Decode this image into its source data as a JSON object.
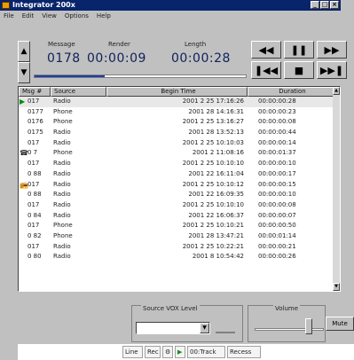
{
  "window": {
    "title": "Integrator 200x",
    "controls": [
      "_",
      "□",
      "×"
    ]
  },
  "menu": [
    "File",
    "Edit",
    "View",
    "Options",
    "Help"
  ],
  "transport": {
    "message_label": "Message",
    "message_value": "0178",
    "render_label": "Render",
    "render_value": "00:00:09",
    "length_label": "Length",
    "length_value": "00:00:28",
    "progress_fraction": 0.33,
    "buttons": {
      "rewind": "◀◀",
      "pause": "❚❚",
      "forward": "▶▶",
      "prev": "❚◀◀",
      "stop": "■",
      "next": "▶▶❚",
      "up": "▲",
      "down": "▼"
    }
  },
  "list": {
    "columns": [
      "Msg #",
      "Source",
      "Begin Time",
      "Duration"
    ],
    "rows": [
      {
        "icon": "play",
        "id": "017",
        "source": "Radio",
        "begin": "2001 2 25 17:16:26",
        "duration": "00:00:00:28"
      },
      {
        "icon": "",
        "id": "0177",
        "source": "Phone",
        "begin": "2001 28 14:16:31",
        "duration": "00:00:00:23"
      },
      {
        "icon": "",
        "id": "0176",
        "source": "Phone",
        "begin": "2001 2 25 13:16:27",
        "duration": "00:00:00:08"
      },
      {
        "icon": "",
        "id": "0175",
        "source": "Radio",
        "begin": "2001 28 13:52:13",
        "duration": "00:00:00:44"
      },
      {
        "icon": "",
        "id": "017",
        "source": "Radio",
        "begin": "2001 2 25 10:10:03",
        "duration": "00:00:00:14"
      },
      {
        "icon": "phone",
        "id": "0 7",
        "source": "Phone",
        "begin": "2001 2 11:08:16",
        "duration": "00:00:01:37"
      },
      {
        "icon": "",
        "id": "017",
        "source": "Radio",
        "begin": "2001 2 25 10:10:10",
        "duration": "00:00:00:10"
      },
      {
        "icon": "",
        "id": "0 88",
        "source": "Radio",
        "begin": "2001 22 16:11:04",
        "duration": "00:00:00:17"
      },
      {
        "icon": "radio",
        "id": "017",
        "source": "Radio",
        "begin": "2001 2 25 10:10:12",
        "duration": "00:00:00:15"
      },
      {
        "icon": "",
        "id": "0 88",
        "source": "Radio",
        "begin": "2001 22 16:09:35",
        "duration": "00:00:00:10"
      },
      {
        "icon": "",
        "id": "017",
        "source": "Radio",
        "begin": "2001 2 25 10:10:10",
        "duration": "00:00:00:08"
      },
      {
        "icon": "",
        "id": "0 84",
        "source": "Radio",
        "begin": "2001 22 16:06:37",
        "duration": "00:00:00:07"
      },
      {
        "icon": "",
        "id": "017",
        "source": "Phone",
        "begin": "2001 2 25 10:10:21",
        "duration": "00:00:00:50"
      },
      {
        "icon": "",
        "id": "0 82",
        "source": "Phone",
        "begin": "2001 28 13:47:21",
        "duration": "00:00:01:14"
      },
      {
        "icon": "",
        "id": "017",
        "source": "Radio",
        "begin": "2001 2 25 10:22:21",
        "duration": "00:00:00:21"
      },
      {
        "icon": "",
        "id": "0 80",
        "source": "Radio",
        "begin": "2001 8 10:54:42",
        "duration": "00:00:00:26"
      }
    ]
  },
  "controls": {
    "source_label": "Source VOX Level",
    "volume_label": "Volume",
    "mute_label": "Mute",
    "volume_fraction": 0.82
  },
  "status": [
    "Line",
    "Rec",
    "⚙",
    "▶",
    "00:Track",
    "Recess"
  ]
}
